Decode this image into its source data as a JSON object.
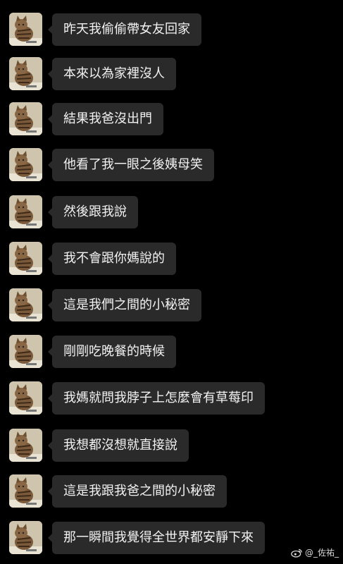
{
  "messages": [
    {
      "text": "昨天我偷偷帶女友回家",
      "avatar": "cat-avatar-icon"
    },
    {
      "text": "本來以為家裡沒人",
      "avatar": "cat-avatar-icon"
    },
    {
      "text": "結果我爸沒出門",
      "avatar": "cat-avatar-icon"
    },
    {
      "text": "他看了我一眼之後姨母笑",
      "avatar": "cat-avatar-icon"
    },
    {
      "text": "然後跟我說",
      "avatar": "cat-avatar-icon"
    },
    {
      "text": "我不會跟你媽說的",
      "avatar": "cat-avatar-icon"
    },
    {
      "text": "這是我們之間的小秘密",
      "avatar": "cat-avatar-icon"
    },
    {
      "text": "剛剛吃晚餐的時候",
      "avatar": "cat-avatar-icon"
    },
    {
      "text": "我媽就問我脖子上怎麼會有草莓印",
      "avatar": "cat-avatar-icon"
    },
    {
      "text": "我想都沒想就直接說",
      "avatar": "cat-avatar-icon"
    },
    {
      "text": "這是我跟我爸之間的小秘密",
      "avatar": "cat-avatar-icon"
    },
    {
      "text": "那一瞬間我覺得全世界都安靜下來",
      "avatar": "cat-avatar-icon"
    }
  ],
  "watermark": {
    "icon": "weibo-icon",
    "text": "@_佐祐_"
  },
  "colors": {
    "background": "#000000",
    "bubble": "#2a2a2a",
    "text": "#f2f2f2"
  }
}
